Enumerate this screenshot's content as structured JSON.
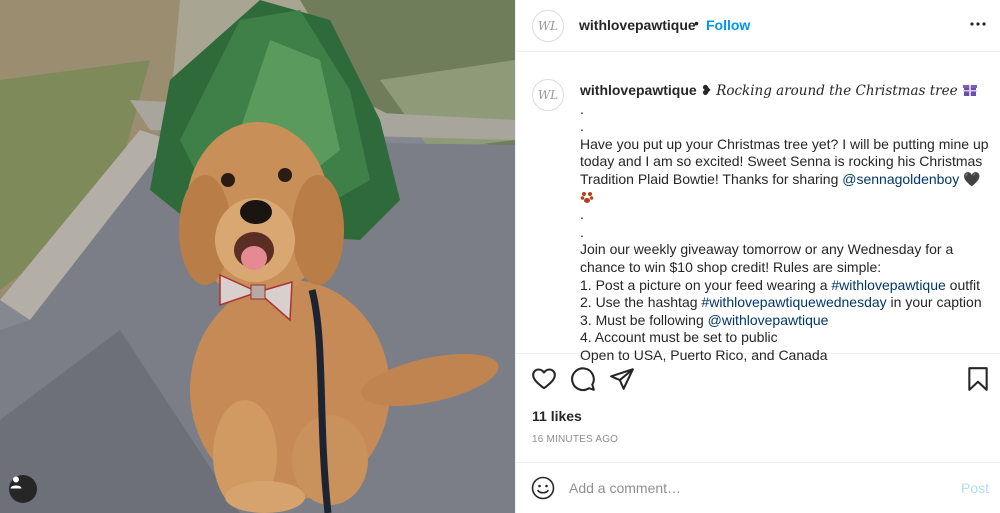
{
  "post": {
    "username": "withlovepawtique",
    "dot": "•",
    "follow_label": "Follow",
    "avatar_monogram": "WL",
    "more_label": "•••"
  },
  "caption": {
    "username": "withlovepawtique",
    "line1_suffix": " ❥ ",
    "line1_script": "Rocking around the Christmas tree",
    "dot1": ".",
    "dot2": ".",
    "para1_a": "Have you put up your Christmas tree yet? I will be putting mine up today and I am so excited! Sweet Senna is rocking his Christmas Tradition Plaid Bowtie! Thanks for sharing ",
    "mention1": "@sennagoldenboy",
    "para1_b": " 🖤",
    "dot3": ".",
    "dot4": ".",
    "para2": "Join our weekly giveaway tomorrow or any Wednesday for a chance to win $10 shop credit! Rules are simple:",
    "rule1_a": "1. Post a picture on your feed wearing a ",
    "rule1_tag": "#withlovepawtique",
    "rule1_b": " outfit",
    "rule2_a": "2. Use the hashtag ",
    "rule2_tag": "#withlovepawtiquewednesday",
    "rule2_b": " in your caption",
    "rule3_a": "3. Must be following ",
    "rule3_tag": "@withlovepawtique",
    "rule4": "4. Account must be set to public",
    "rule5": "Open to USA, Puerto Rico, and Canada"
  },
  "actions": {
    "icons": [
      "heart-icon",
      "comment-icon",
      "share-icon",
      "bookmark-icon"
    ]
  },
  "likes": "11 likes",
  "timestamp": "16 MINUTES AGO",
  "comment": {
    "placeholder": "Add a comment…",
    "post_label": "Post"
  },
  "colors": {
    "follow_blue": "#0095f6",
    "link_blue": "#00376b",
    "post_disabled": "#b3dbff",
    "muted": "#8e8e8e"
  }
}
